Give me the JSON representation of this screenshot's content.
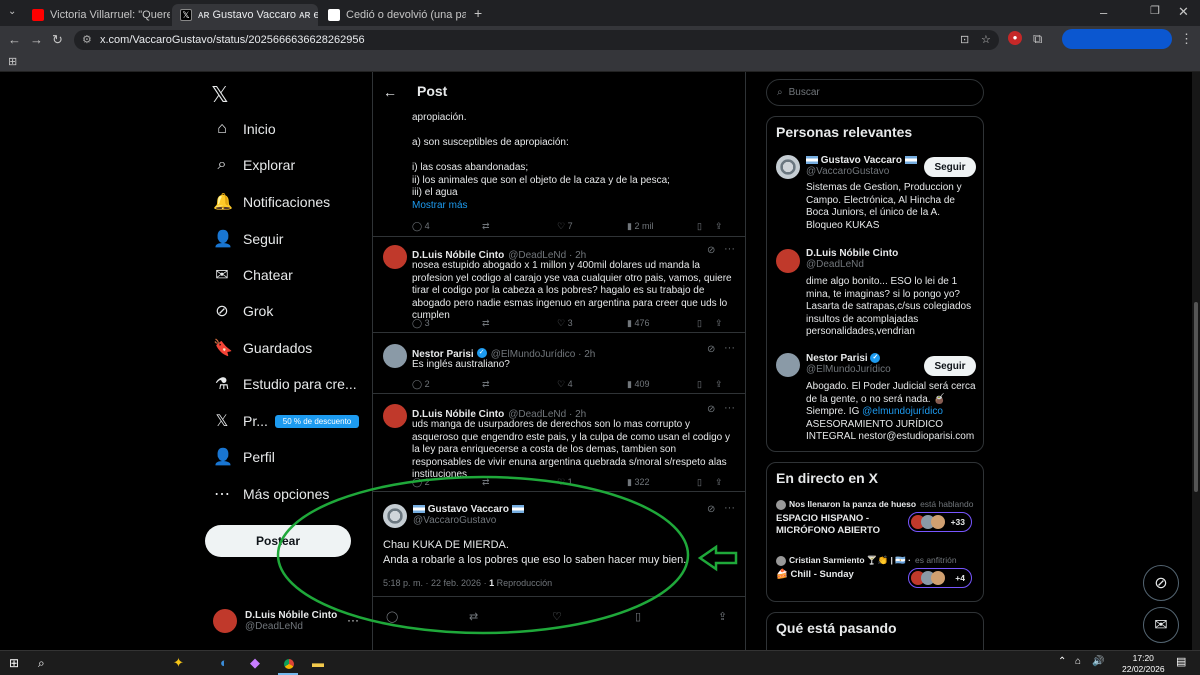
{
  "browser": {
    "tabs": [
      {
        "title": "Victoria Villarruel: \"Queremos b",
        "favicon_color": "#ff0000"
      },
      {
        "title": "ᴀʀ Gustavo Vaccaro ᴀʀ en X: \"©",
        "favicon_color": "#000000"
      },
      {
        "title": "Cedió o devolvió (una parte) - L",
        "favicon_color": "#ffffff"
      }
    ],
    "url": "x.com/VaccaroGustavo/status/2025666636628262956"
  },
  "nav": {
    "items": [
      {
        "label": "Inicio",
        "icon": "home-icon",
        "glyph": "⌂"
      },
      {
        "label": "Explorar",
        "icon": "search-icon",
        "glyph": "⌕"
      },
      {
        "label": "Notificaciones",
        "icon": "bell-icon",
        "glyph": "🔔"
      },
      {
        "label": "Seguir",
        "icon": "add-person-icon",
        "glyph": "👤"
      },
      {
        "label": "Chatear",
        "icon": "mail-icon",
        "glyph": "✉"
      },
      {
        "label": "Grok",
        "icon": "grok-icon",
        "glyph": "⊘"
      },
      {
        "label": "Guardados",
        "icon": "bookmark-icon",
        "glyph": "🔖"
      },
      {
        "label": "Estudio para cre...",
        "icon": "flask-icon",
        "glyph": "⚗"
      },
      {
        "label": "Pr...",
        "icon": "x-logo-icon",
        "glyph": "𝕏"
      },
      {
        "label": "Perfil",
        "icon": "person-icon",
        "glyph": "👤"
      },
      {
        "label": "Más opciones",
        "icon": "more-icon",
        "glyph": "⋯"
      }
    ],
    "premium_badge": "50 % de descuento",
    "post_button": "Postear",
    "account": {
      "name": "D.Luis Nóbile Cinto",
      "handle": "@DeadLeNd"
    }
  },
  "header": {
    "title": "Post"
  },
  "main_tweet_fragment": {
    "lines": [
      "apropiación.",
      "",
      "a) son susceptibles de apropiación:",
      "",
      "i) las cosas abandonadas;",
      "ii) los animales que son el objeto de la caza y de la pesca;",
      "iii) el agua"
    ],
    "show_more": "Mostrar más",
    "actions": {
      "replies": "4",
      "retweets": "",
      "likes": "7",
      "views": "2 mil"
    }
  },
  "replies": [
    {
      "name": "D.Luis Nóbile Cinto",
      "handle": "@DeadLeNd · 2h",
      "text": "nosea estupido abogado x 1 millon y 400mil dolares ud manda la profesion yel codigo al carajo yse vaa cualquier otro pais, vamos, quiere tirar el codigo por la cabeza a los pobres? hagalo es su trabajo de abogado pero nadie esmas ingenuo en argentina para creer que uds lo cumplen",
      "replies": "3",
      "likes": "3",
      "views": "476"
    },
    {
      "name": "Nestor Parisi",
      "handle": "@ElMundoJurídico · 2h",
      "text": "Es inglés australiano?",
      "replies": "2",
      "likes": "4",
      "views": "409"
    },
    {
      "name": "D.Luis Nóbile Cinto",
      "handle": "@DeadLeNd · 2h",
      "text": "uds manga de usurpadores de derechos son lo mas corrupto y asqueroso que engendro este pais, y la culpa de como usan el codigo y la ley para enriquecerse a costa de los demas, tambien son responsables de vivir enuna argentina quebrada s/moral s/respeto alas instituciones",
      "replies": "2",
      "likes": "1",
      "views": "322"
    }
  ],
  "focus_tweet": {
    "name": "Gustavo Vaccaro",
    "handle": "@VaccaroGustavo",
    "line1": "Chau KUKA DE MIERDA.",
    "line2": "Anda a robarle a los pobres que eso lo saben hacer muy bien.",
    "meta": "5:18 p. m. · 22 feb. 2026 · ",
    "views_count": "1",
    "views_label": " Reproducción"
  },
  "sidebar": {
    "search_placeholder": "Buscar",
    "relevant_title": "Personas relevantes",
    "people": [
      {
        "name": "Gustavo Vaccaro",
        "handle": "@VaccaroGustavo",
        "bio": "Sistemas de Gestion, Produccion y Campo. Electrónica, Al Hincha de Boca Juniors, el único de la A. Bloqueo KUKAS",
        "follow": "Seguir"
      },
      {
        "name": "D.Luis Nóbile Cinto",
        "handle": "@DeadLeNd",
        "bio": "dime algo bonito... ESO lo lei de 1 mina, te imaginas? si lo pongo yo? Lasarta de satrapas,c/sus colegiados insultos de acomplajadas personalidades,vendrian",
        "follow": ""
      },
      {
        "name": "Nestor Parisi",
        "handle": "@ElMundoJurídico",
        "bio": "Abogado. El Poder Judicial será cerca de la gente, o no será nada. 🧉 Siempre. IG ",
        "bio_link": "@elmundojurídico",
        "bio2": "ASESORAMIENTO JURÍDICO INTEGRAL nestor@estudioparisi.com",
        "follow": "Seguir"
      }
    ],
    "live_title": "En directo en X",
    "spaces": [
      {
        "host": "Nos llenaron la panza de hueso",
        "status": "está hablando",
        "title": "ESPACIO HISPANO - MICRÓFONO ABIERTO",
        "count": "+33"
      },
      {
        "host": "Cristian Sarmiento 🍸👏 | 🇦🇷 ·",
        "status": "es anfitrión",
        "title": "🍰 Chill - Sunday",
        "count": "+4"
      }
    ],
    "trending_title": "Qué está pasando"
  },
  "taskbar": {
    "time": "17:20",
    "date": "22/02/2026"
  },
  "colors": {
    "accent": "#1d9bf0",
    "annotation": "#1fa83a",
    "premium": "#1d9bf0"
  }
}
